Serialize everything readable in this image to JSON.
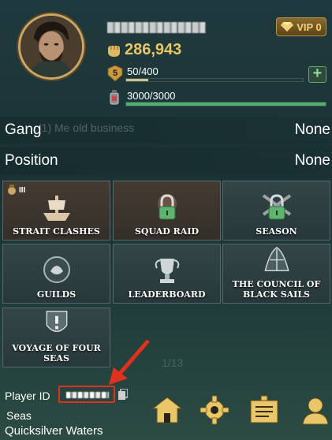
{
  "header": {
    "vip_label": "VIP 0",
    "currency": "286,943",
    "level": "5",
    "xp_text": "50/400",
    "xp_progress": 0.125,
    "energy_text": "3000/3000",
    "energy_progress": 1.0
  },
  "rows": {
    "gang_label": "Gang",
    "gang_value": "None",
    "gang_ghost": "(1) Me old business",
    "position_label": "Position",
    "position_value": "None"
  },
  "tiles": [
    {
      "label": "STRAIT CLASHES",
      "badge": "III"
    },
    {
      "label": "SQUAD RAID"
    },
    {
      "label": "SEASON"
    },
    {
      "label": "GUILDS"
    },
    {
      "label": "LEADERBOARD"
    },
    {
      "label": "THE COUNCIL OF BLACK SAILS"
    },
    {
      "label": "VOYAGE OF FOUR SEAS"
    }
  ],
  "footer": {
    "player_id_label": "Player ID",
    "season_label": "Seas",
    "season_value": "Quicksilver Waters",
    "bg_counter": "1/13"
  },
  "colors": {
    "accent_gold": "#e9c668",
    "energy_green": "#4fb16b",
    "highlight_red": "#e0301e"
  }
}
